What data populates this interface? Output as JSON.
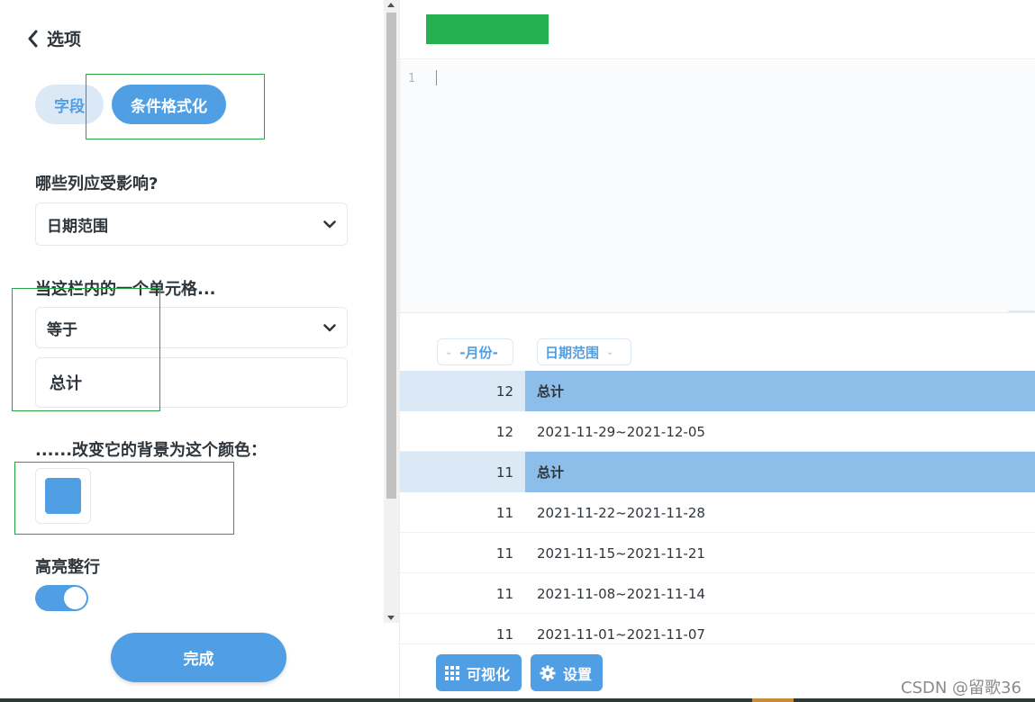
{
  "sidebar": {
    "back_title": "选项",
    "tabs": [
      {
        "label": "字段",
        "active": false
      },
      {
        "label": "条件格式化",
        "active": true
      }
    ],
    "columns_question": "哪些列应受影响?",
    "columns_value": "日期范围",
    "cell_question": "当这栏内的一个单元格...",
    "operator_value": "等于",
    "match_value": "总计",
    "color_question": "......改变它的背景为这个颜色：",
    "color_value": "#509ee3",
    "highlight_row_label": "高亮整行",
    "highlight_row_on": true,
    "done_label": "完成"
  },
  "editor": {
    "line_number": "1"
  },
  "results": {
    "columns": [
      "-月份-",
      "日期范围"
    ],
    "rows": [
      {
        "month": "12",
        "range": "总计",
        "highlight": true
      },
      {
        "month": "12",
        "range": "2021-11-29~2021-12-05",
        "highlight": false
      },
      {
        "month": "11",
        "range": "总计",
        "highlight": true
      },
      {
        "month": "11",
        "range": "2021-11-22~2021-11-28",
        "highlight": false
      },
      {
        "month": "11",
        "range": "2021-11-15~2021-11-21",
        "highlight": false
      },
      {
        "month": "11",
        "range": "2021-11-08~2021-11-14",
        "highlight": false
      },
      {
        "month": "11",
        "range": "2021-11-01~2021-11-07",
        "highlight": false
      }
    ]
  },
  "bottom_bar": {
    "visualize_label": "可视化",
    "settings_label": "设置"
  },
  "watermark": "CSDN @留歌36",
  "colors": {
    "accent": "#509ee3",
    "highlight_cell": "#8dbde9",
    "highlight_row": "#dbe9f6",
    "green_button": "#27b04f"
  }
}
